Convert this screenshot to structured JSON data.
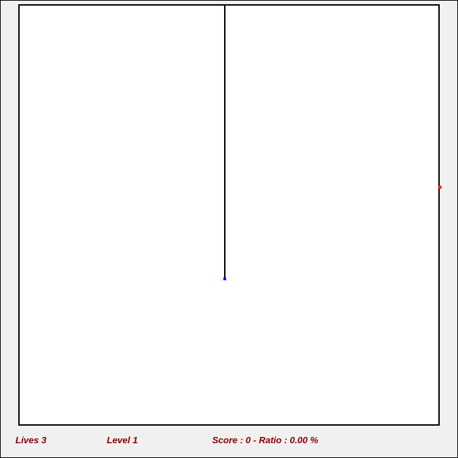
{
  "game": {
    "status": {
      "lives": "Lives 3",
      "level": "Level 1",
      "score": "Score : 0 - Ratio : 0.00 %"
    },
    "colors": {
      "playfield": "#ffffff",
      "border": "#000000",
      "trail": "#000000",
      "player": "#1010ff",
      "enemy": "#ff2020",
      "status_text": "#8b0000",
      "background": "#f0f0f0"
    }
  }
}
